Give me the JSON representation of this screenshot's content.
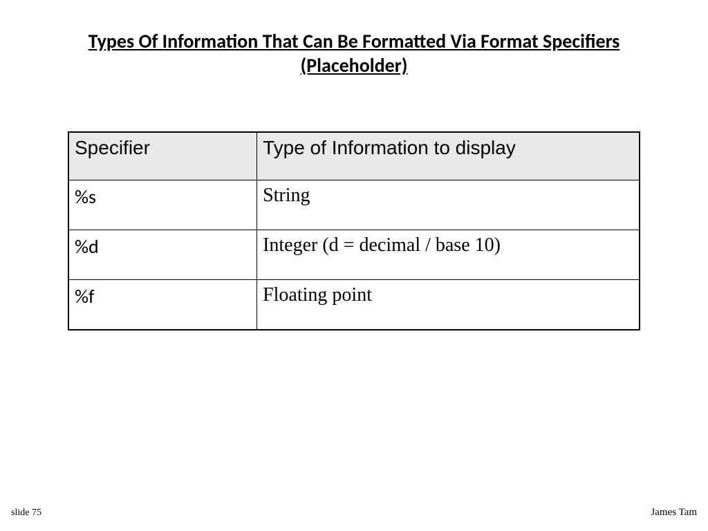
{
  "title_line1": "Types Of Information That Can Be Formatted Via Format Specifiers",
  "title_line2": "(Placeholder)",
  "table": {
    "headers": {
      "col0": "Specifier",
      "col1": "Type of Information to display"
    },
    "rows": [
      {
        "spec": "%s",
        "desc": "String"
      },
      {
        "spec": "%d",
        "desc": "Integer (d = decimal / base 10)"
      },
      {
        "spec": "%f",
        "desc": "Floating point"
      }
    ]
  },
  "footer": {
    "left": "slide 75",
    "right": "James Tam"
  }
}
